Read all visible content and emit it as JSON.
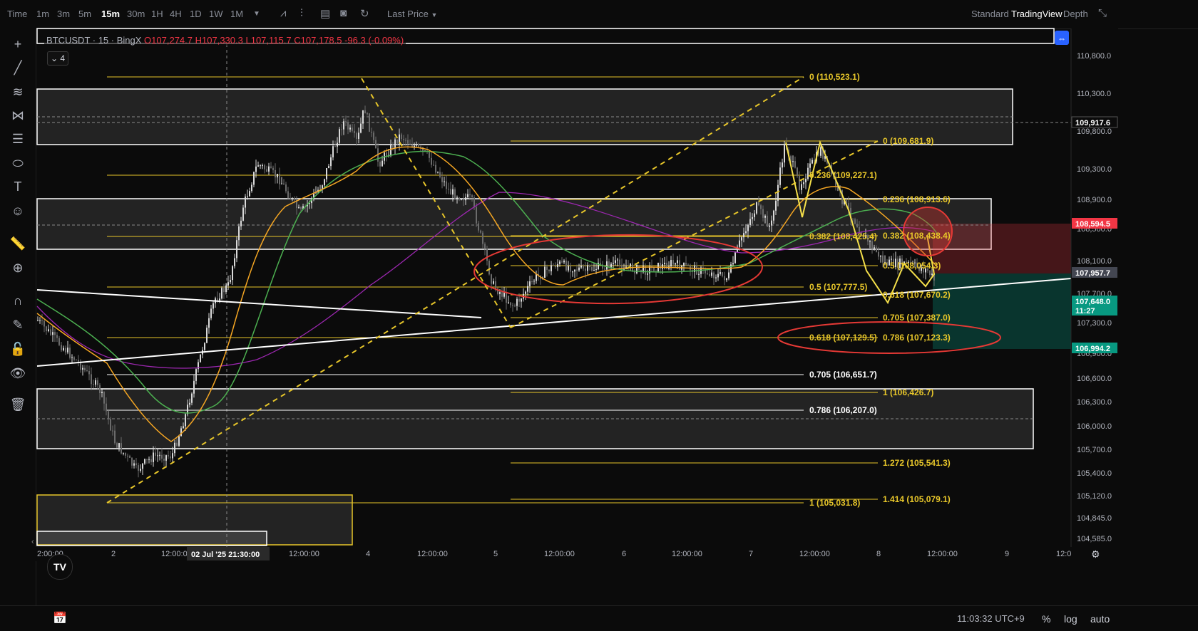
{
  "topbar": {
    "time_label": "Time",
    "intervals": [
      "1m",
      "3m",
      "5m",
      "15m",
      "30m",
      "1H",
      "4H",
      "1D",
      "1W",
      "1M"
    ],
    "active_interval": "15m",
    "price_source": "Last Price",
    "view_modes": [
      "Standard",
      "TradingView",
      "Depth"
    ],
    "active_view": "TradingView"
  },
  "legend": {
    "symbol": "BTCUSDT · 15 · BingX",
    "open": "O107,274.7",
    "high": "H107,330.3",
    "low": "L107,115.7",
    "close": "C107,178.5",
    "change": "-96.3 (-0.09%)",
    "indicator_count": "4"
  },
  "price_axis": {
    "ticks": [
      "110,800.0",
      "110,300.0",
      "109,800.0",
      "109,300.0",
      "108,900.0",
      "108,500.0",
      "108,100.0",
      "107,700.0",
      "107,300.0",
      "106,900.0",
      "106,600.0",
      "106,300.0",
      "106,000.0",
      "105,700.0",
      "105,400.0",
      "105,120.0",
      "104,845.0",
      "104,585.0"
    ],
    "badges": [
      {
        "text": "109,917.6",
        "color": "#ffffff",
        "bg": "#0b0b0b"
      },
      {
        "text": "108,594.5",
        "color": "#ffffff",
        "bg": "#f23645"
      },
      {
        "text": "107,957.7",
        "color": "#ffffff",
        "bg": "#434651"
      },
      {
        "text": "107,648.0",
        "sub": "11:27",
        "color": "#ffffff",
        "bg": "#089981"
      },
      {
        "text": "106,994.2",
        "color": "#ffffff",
        "bg": "#089981"
      }
    ]
  },
  "time_axis": {
    "ticks": [
      "2:00:00",
      "2",
      "12:00:0",
      "12:00:00",
      "4",
      "12:00:00",
      "5",
      "12:00:00",
      "6",
      "12:00:00",
      "7",
      "12:00:00",
      "8",
      "12:00:00",
      "9",
      "12:0"
    ],
    "crosshair_label": "02 Jul '25   21:30:00"
  },
  "fib_labels": {
    "set_a": [
      "0 (110,523.1)",
      "0.236 (109,227.1)",
      "0.382 (108,425.4)",
      "0.5 (107,777.5)",
      "0.618 (107,129.5)",
      "0.705 (106,651.7)",
      "0.786 (106,207.0)",
      "1 (105,031.8)"
    ],
    "set_b": [
      "0 (109,681.9)",
      "0.236 (108,913.6)",
      "0.382 (108,438.4)",
      "0.5 (108,054.3)",
      "0.618 (107,670.2)",
      "0.705 (107,387.0)",
      "0.786 (107,123.3)",
      "1 (106,426.7)",
      "1.272 (105,541.3)",
      "1.414 (105,079.1)"
    ]
  },
  "bottombar": {
    "clock": "11:03:32 UTC+9",
    "percent": "%",
    "log": "log",
    "auto": "auto"
  },
  "colors": {
    "background": "#0b0b0b",
    "fib_line": "#e7c62a",
    "ema_orange": "#f5a623",
    "ema_green": "#4caf50",
    "ema_purple": "#9c27b0",
    "trend": "#ffffff",
    "ellipse": "#e53935",
    "zone_red": "#f23645",
    "zone_green": "#089981"
  }
}
